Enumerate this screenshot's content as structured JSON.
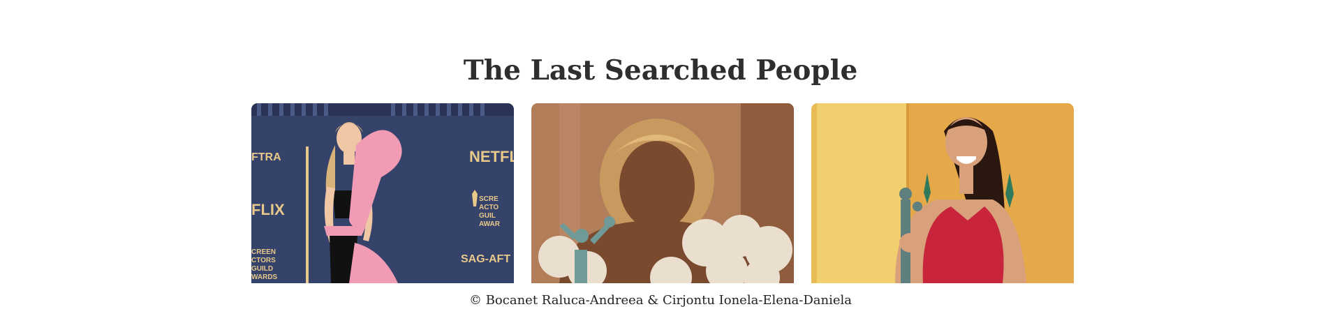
{
  "title": "The Last Searched People",
  "cards": [
    {
      "name": "",
      "backdrop_text": [
        "FTRA",
        "NETFL",
        "FLIX",
        "SCRE",
        "ACTO",
        "GUIL",
        "AWAR",
        "CREEN",
        "CTORS",
        "GUILD",
        "WARDS",
        "SAG-AFT"
      ],
      "colors": {
        "backdrop": "#35426a",
        "accent": "#e8c98a",
        "dress": "#f29bb5",
        "top": "#111111"
      }
    },
    {
      "name": "",
      "colors": {
        "backdrop": "#b27d59",
        "hair": "#c89a5f",
        "skin": "#7a4a2e",
        "dress": "#eadfcf",
        "statue": "#6f9a98"
      }
    },
    {
      "name": "",
      "colors": {
        "backdrop": "#e6a94a",
        "panel": "#f2cf6e",
        "dress": "#c8243c",
        "hair": "#2a1810",
        "statue": "#5f7f7e"
      }
    }
  ],
  "footer": "© Bocanet Raluca-Andreea & Cirjontu Ionela-Elena-Daniela"
}
